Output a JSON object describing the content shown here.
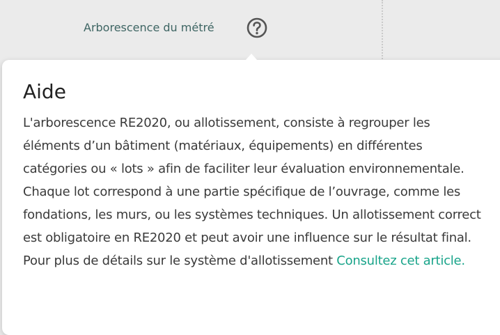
{
  "header": {
    "tree_label": "Arborescence du métré",
    "help_icon": "question-circle-icon"
  },
  "help_popover": {
    "title": "Aide",
    "body_text": "L'arborescence RE2020, ou allotissement, consiste à regrouper les éléments d’un bâtiment (matériaux, équipements) en différentes catégories ou « lots » afin de faciliter leur évaluation environnementale. Chaque lot correspond à une partie spécifique de l’ouvrage, comme les fondations, les murs, ou les systèmes techniques. Un allotissement correct est obligatoire en RE2020 et peut avoir une influence sur le résultat final. Pour plus de détails sur le système d'allotissement",
    "link_text": "Consultez cet article."
  },
  "colors": {
    "background": "#ebebeb",
    "label": "#3e6563",
    "link": "#19a48a",
    "popover": "#ffffff"
  }
}
